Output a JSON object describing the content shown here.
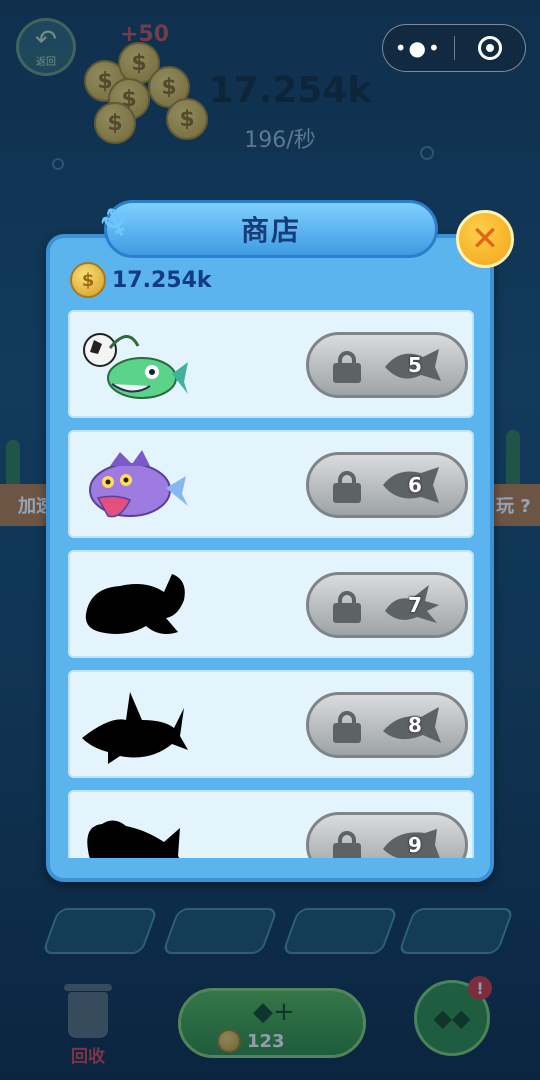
{
  "hud": {
    "back_label": "返回",
    "coin_gain": "+50",
    "score": "17.254k",
    "rate": "196/秒",
    "left_side_label": "加速",
    "right_side_label": "玩 ?"
  },
  "shop": {
    "title": "商店",
    "balance": "17.254k",
    "items": [
      {
        "name": "anglerfish",
        "locked": true,
        "level": "5"
      },
      {
        "name": "purple-fish",
        "locked": true,
        "level": "6"
      },
      {
        "name": "unknown-fish",
        "locked": true,
        "level": "7"
      },
      {
        "name": "unknown-shark",
        "locked": true,
        "level": "8"
      },
      {
        "name": "unknown-fish",
        "locked": true,
        "level": "9"
      }
    ]
  },
  "bottom": {
    "recycle_label": "回收",
    "buy_cost": "123",
    "notification_badge": "!"
  },
  "colors": {
    "modal_bg": "#5cb4ee",
    "title_text": "#173d78",
    "balance_text": "#123a86",
    "locked_btn": "#b5b9bc"
  }
}
